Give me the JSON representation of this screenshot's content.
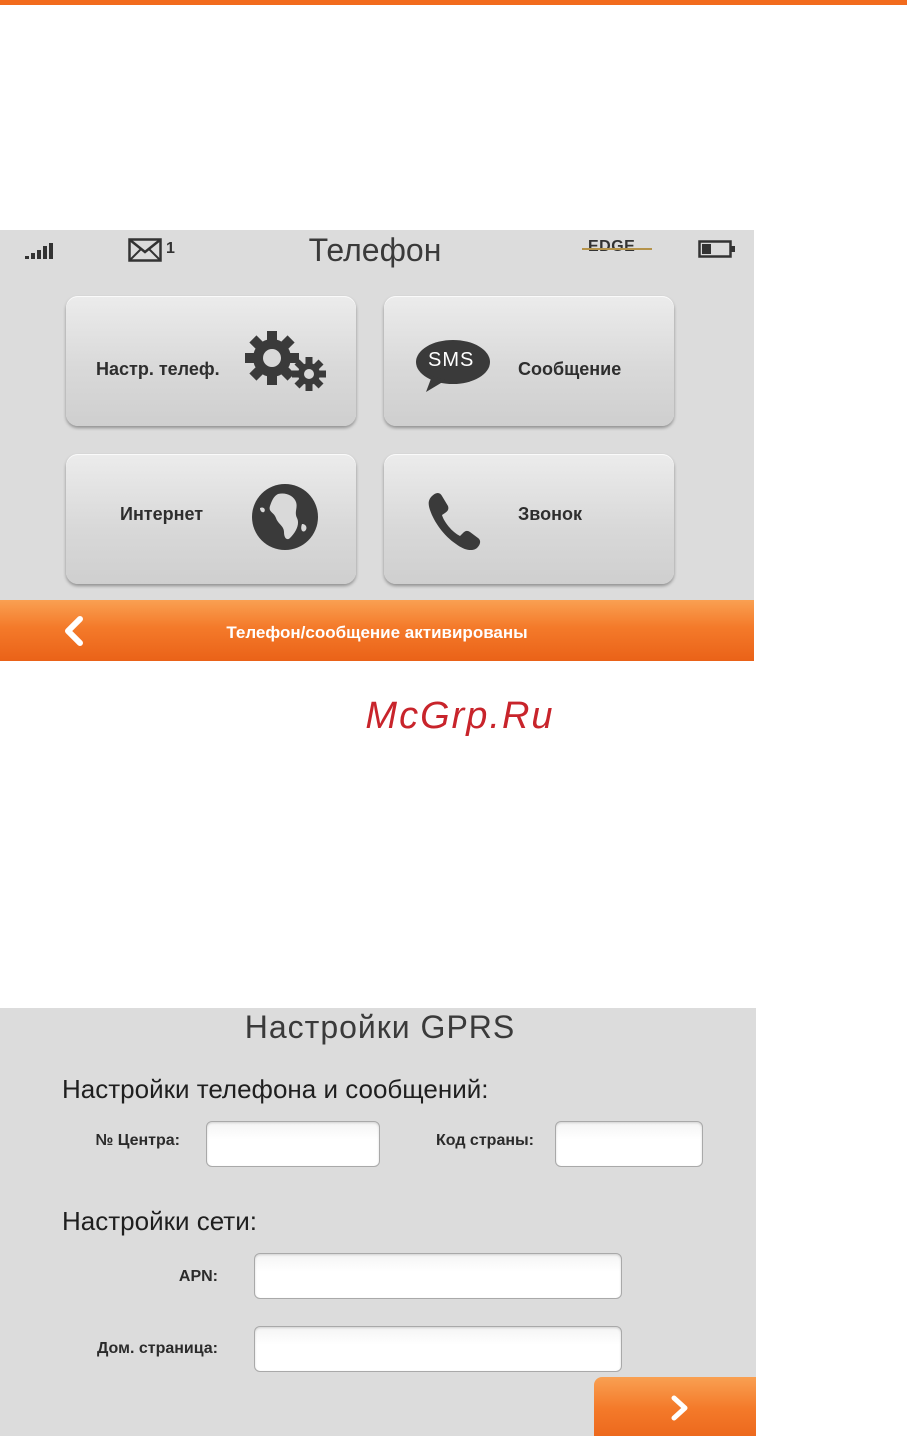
{
  "screen1": {
    "title": "Телефон",
    "status": {
      "unread_messages": "1",
      "network": "EDGE"
    },
    "tiles": [
      {
        "label": "Настр. телеф.",
        "icon": "gears-icon"
      },
      {
        "label": "Сообщение",
        "icon": "sms-bubble-icon",
        "icon_text": "SMS"
      },
      {
        "label": "Интернет",
        "icon": "globe-icon"
      },
      {
        "label": "Звонок",
        "icon": "phone-handset-icon"
      }
    ],
    "bottom_bar": {
      "status_text": "Телефон/сообщение активированы"
    }
  },
  "watermark": "McGrp.Ru",
  "screen2": {
    "title": "Настройки GPRS",
    "phone_section": {
      "heading": "Настройки телефона и сообщений:",
      "center_label": "№ Центра:",
      "center_value": "",
      "country_label": "Код страны:",
      "country_value": ""
    },
    "network_section": {
      "heading": "Настройки сети:",
      "apn_label": "APN:",
      "apn_value": "",
      "homepage_label": "Дом. страница:",
      "homepage_value": ""
    }
  },
  "colors": {
    "accent_orange": "#f47a2a",
    "screen_background": "#dcdcdc",
    "watermark_red": "#c8242b"
  }
}
